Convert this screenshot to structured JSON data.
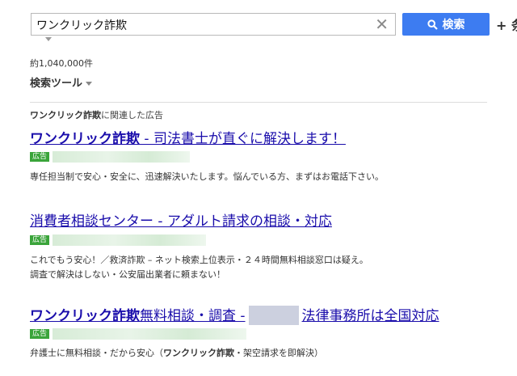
{
  "search": {
    "query": "ワンクリック詐欺",
    "button_label": "検索",
    "extra_label": "+ 条"
  },
  "results_count": "約1,040,000件",
  "search_tools_label": "検索ツール",
  "related_ads": {
    "keyword": "ワンクリック詐欺",
    "suffix": "に関連した広告"
  },
  "ads": [
    {
      "title_kw": "ワンクリック詐欺",
      "title_rest": " - 司法書士が直ぐに解決します！",
      "badge": "広告",
      "desc_lines": [
        "専任担当制で安心・安全に、迅速解決いたします。悩んでいる方、まずはお電話下さい。"
      ]
    },
    {
      "title_kw": "",
      "title_rest": "消費者相談センター - アダルト請求の相談・対応",
      "badge": "広告",
      "desc_lines": [
        "これでもう安心！／救済詐欺 – ネット検索上位表示・２４時間無料相談窓口は疑え。",
        "調査で解決はしない・公安届出業者に頼まない！"
      ]
    },
    {
      "title_kw": "ワンクリック詐欺",
      "title_rest": "無料相談・調査 -",
      "title_after": "法律事務所は全国対応",
      "badge": "広告",
      "desc_pre": "弁護士に無料相談・だから安心（",
      "desc_kw": "ワンクリック詐欺",
      "desc_post": "・架空請求を即解決）"
    }
  ],
  "colors": {
    "accent": "#3d7cf1",
    "link": "#1a0dab",
    "ad_badge": "#3aa43a"
  },
  "icons": [
    "clear-icon",
    "search-icon",
    "chevron-down-icon"
  ]
}
